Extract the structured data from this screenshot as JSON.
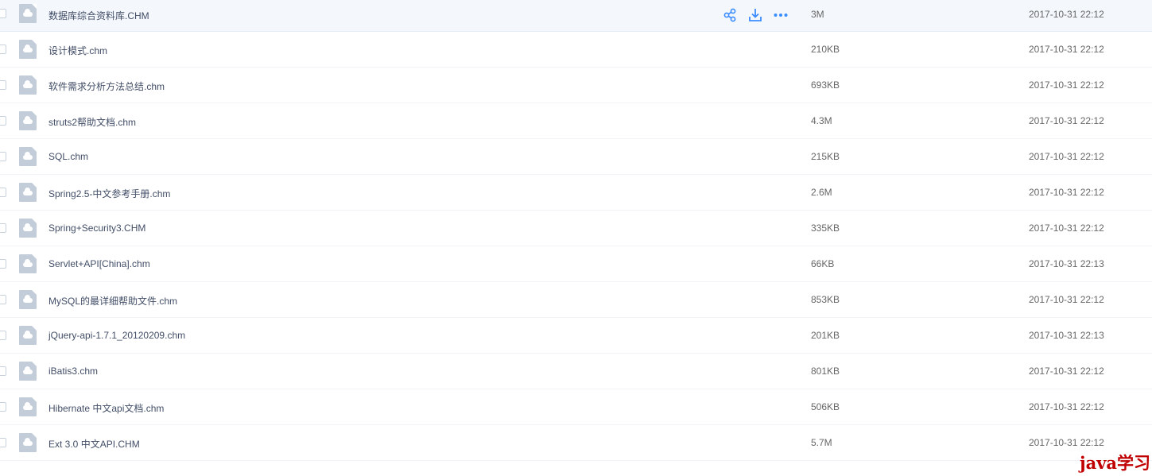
{
  "files": [
    {
      "name": "数据库综合资料库.CHM",
      "size": "3M",
      "modified": "2017-10-31 22:12"
    },
    {
      "name": "设计模式.chm",
      "size": "210KB",
      "modified": "2017-10-31 22:12"
    },
    {
      "name": "软件需求分析方法总结.chm",
      "size": "693KB",
      "modified": "2017-10-31 22:12"
    },
    {
      "name": "struts2帮助文档.chm",
      "size": "4.3M",
      "modified": "2017-10-31 22:12"
    },
    {
      "name": "SQL.chm",
      "size": "215KB",
      "modified": "2017-10-31 22:12"
    },
    {
      "name": "Spring2.5-中文参考手册.chm",
      "size": "2.6M",
      "modified": "2017-10-31 22:12"
    },
    {
      "name": "Spring+Security3.CHM",
      "size": "335KB",
      "modified": "2017-10-31 22:12"
    },
    {
      "name": "Servlet+API[China].chm",
      "size": "66KB",
      "modified": "2017-10-31 22:13"
    },
    {
      "name": "MySQL的最详细帮助文件.chm",
      "size": "853KB",
      "modified": "2017-10-31 22:12"
    },
    {
      "name": "jQuery-api-1.7.1_20120209.chm",
      "size": "201KB",
      "modified": "2017-10-31 22:13"
    },
    {
      "name": "iBatis3.chm",
      "size": "801KB",
      "modified": "2017-10-31 22:12"
    },
    {
      "name": "Hibernate 中文api文档.chm",
      "size": "506KB",
      "modified": "2017-10-31 22:12"
    },
    {
      "name": "Ext 3.0 中文API.CHM",
      "size": "5.7M",
      "modified": "2017-10-31 22:12"
    }
  ],
  "hovered_row_actions": [
    "share-icon",
    "download-icon",
    "more-icon"
  ],
  "file_icon": "cloud-file-icon",
  "colors": {
    "accent": "#3b8cff",
    "hover_row": "#f4f8fd",
    "name_text": "#424e67",
    "meta_text": "#666666",
    "watermark": "#c00000"
  },
  "watermark": {
    "text": "java学习"
  }
}
